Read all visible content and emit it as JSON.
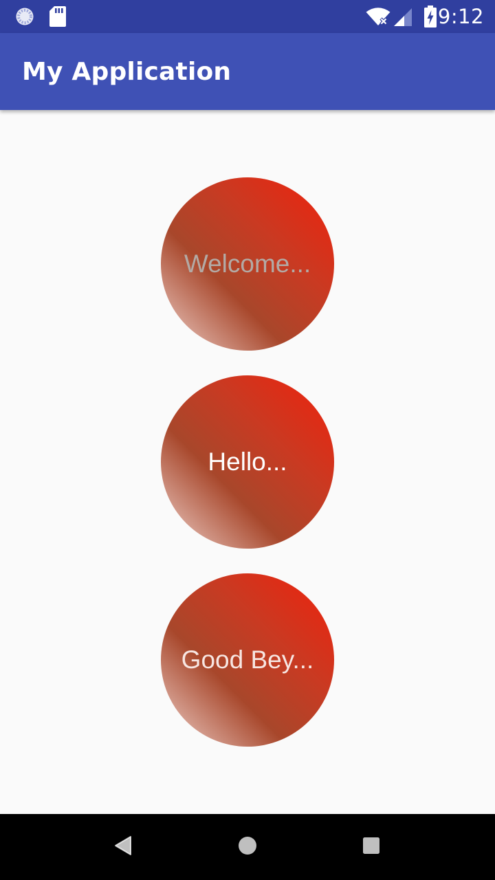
{
  "status_bar": {
    "time": "9:12",
    "left_icons": [
      "sync-icon",
      "sd-card-icon"
    ],
    "right_icons": [
      "wifi-icon",
      "cell-signal-icon",
      "battery-charging-icon"
    ],
    "background": "#303f9f"
  },
  "app_bar": {
    "title": "My Application",
    "background": "#3f51b5"
  },
  "buttons": [
    {
      "label": "Welcome...",
      "text_color": "#b3aaa5"
    },
    {
      "label": "Hello...",
      "text_color": "#ffffff"
    },
    {
      "label": "Good Bey...",
      "text_color": "#f7e6e2"
    }
  ],
  "button_gradient": [
    "#f0210c",
    "#c93a22",
    "#a8472b",
    "#f0d5cf"
  ],
  "nav_bar": {
    "icons": [
      "back-icon",
      "home-icon",
      "recents-icon"
    ],
    "background": "#000000"
  }
}
